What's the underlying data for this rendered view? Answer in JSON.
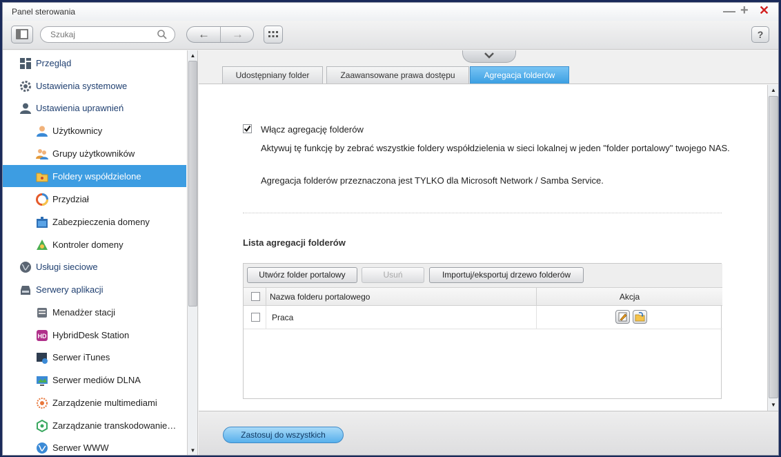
{
  "window": {
    "title": "Panel sterowania"
  },
  "toolbar": {
    "search_placeholder": "Szukaj"
  },
  "sidebar": {
    "items": [
      {
        "label": "Przegląd",
        "icon": "overview-icon"
      },
      {
        "label": "Ustawienia systemowe",
        "icon": "gear-icon"
      },
      {
        "label": "Ustawienia uprawnień",
        "icon": "user-icon"
      },
      {
        "label": "Użytkownicy",
        "icon": "users-icon"
      },
      {
        "label": "Grupy użytkowników",
        "icon": "user-groups-icon"
      },
      {
        "label": "Foldery współdzielone",
        "icon": "shared-folder-icon"
      },
      {
        "label": "Przydział",
        "icon": "quota-pie-icon"
      },
      {
        "label": "Zabezpieczenia domeny",
        "icon": "domain-security-icon"
      },
      {
        "label": "Kontroler domeny",
        "icon": "domain-controller-icon"
      },
      {
        "label": "Usługi sieciowe",
        "icon": "network-globe-icon"
      },
      {
        "label": "Serwery aplikacji",
        "icon": "app-server-icon"
      },
      {
        "label": "Menadżer stacji",
        "icon": "station-manager-icon"
      },
      {
        "label": "HybridDesk Station",
        "icon": "hybriddesk-icon"
      },
      {
        "label": "Serwer iTunes",
        "icon": "itunes-icon"
      },
      {
        "label": "Serwer mediów DLNA",
        "icon": "dlna-icon"
      },
      {
        "label": "Zarządzenie multimediami",
        "icon": "multimedia-icon"
      },
      {
        "label": "Zarządzanie transkodowanie…",
        "icon": "transcode-icon"
      },
      {
        "label": "Serwer WWW",
        "icon": "web-server-icon"
      }
    ]
  },
  "tabs": [
    {
      "label": "Udostępniany folder"
    },
    {
      "label": "Zaawansowane prawa dostępu"
    },
    {
      "label": "Agregacja folderów"
    }
  ],
  "aggregation": {
    "enable_label": "Włącz agregację folderów",
    "enabled": true,
    "description": "Aktywuj tę funkcję by zebrać wszystkie foldery współdzielenia w sieci lokalnej w jeden \"folder portalowy\" twojego NAS.",
    "note": "Agregacja folderów przeznaczona jest TYLKO dla Microsoft Network / Samba Service."
  },
  "list": {
    "title": "Lista agregacji folderów",
    "buttons": {
      "create": "Utwórz folder portalowy",
      "delete": "Usuń",
      "import_export": "Importuj/eksportuj drzewo folderów"
    },
    "columns": {
      "name": "Nazwa folderu portalowego",
      "action": "Akcja"
    },
    "rows": [
      {
        "name": "Praca"
      }
    ]
  },
  "footer": {
    "apply_label": "Zastosuj do wszystkich"
  },
  "colors": {
    "accent": "#3d9de2",
    "close": "#d21f1f"
  }
}
